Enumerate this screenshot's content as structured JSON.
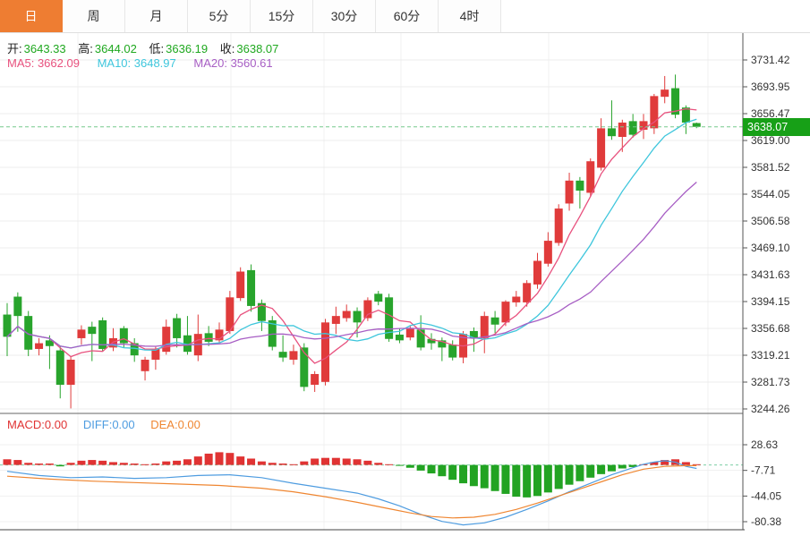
{
  "tabs": {
    "items": [
      {
        "label": "日",
        "active": true
      },
      {
        "label": "周",
        "active": false
      },
      {
        "label": "月",
        "active": false
      },
      {
        "label": "5分",
        "active": false
      },
      {
        "label": "15分",
        "active": false
      },
      {
        "label": "30分",
        "active": false
      },
      {
        "label": "60分",
        "active": false
      },
      {
        "label": "4时",
        "active": false
      }
    ]
  },
  "ohlc_legend": {
    "open_label": "开:",
    "open_value": "3643.33",
    "high_label": "高:",
    "high_value": "3644.02",
    "low_label": "低:",
    "low_value": "3636.19",
    "close_label": "收:",
    "close_value": "3638.07"
  },
  "ma_legend": {
    "ma5": "MA5: 3662.09",
    "ma10": "MA10: 3648.97",
    "ma20": "MA20: 3560.61"
  },
  "macd_legend": {
    "macd": "MACD:0.00",
    "diff": "DIFF:0.00",
    "dea": "DEA:0.00"
  },
  "price_tag": {
    "value": "3638.07"
  },
  "colors": {
    "accent_orange": "#ee7d32",
    "up_red": "#e03b3b",
    "down_green": "#28a42c",
    "tag_green": "#17a017",
    "ohlc_value_green": "#1fa81f",
    "ma5_pink": "#e8517e",
    "ma10_cyan": "#3ec6dc",
    "ma20_purple": "#a75ec4",
    "diff_blue": "#4e9ce0",
    "dea_orange": "#ef8631"
  },
  "chart_data": {
    "type": "candlestick+macd",
    "grid_x": [
      87,
      258,
      362,
      448,
      613,
      791
    ],
    "main": {
      "title": "",
      "ylabel": "price",
      "ylim": [
        3244.26,
        3731.42
      ],
      "y_ticks": [
        3731.42,
        3693.95,
        3656.47,
        3619.0,
        3581.52,
        3544.05,
        3506.58,
        3469.1,
        3431.63,
        3394.15,
        3356.68,
        3319.21,
        3281.73,
        3244.26
      ],
      "last_price": 3638.07,
      "up_color": "#e03b3b",
      "down_color": "#28a42c",
      "ma_periods": [
        5,
        10,
        20
      ],
      "ma_colors": [
        "#e8517e",
        "#3ec6dc",
        "#a75ec4"
      ],
      "ohlc": [
        [
          3376,
          3392,
          3318,
          3345
        ],
        [
          3401,
          3407,
          3352,
          3374
        ],
        [
          3374,
          3381,
          3318,
          3327
        ],
        [
          3328,
          3343,
          3319,
          3336
        ],
        [
          3340,
          3347,
          3300,
          3332
        ],
        [
          3326,
          3332,
          3259,
          3278
        ],
        [
          3278,
          3318,
          3245,
          3313
        ],
        [
          3343,
          3361,
          3334,
          3355
        ],
        [
          3359,
          3366,
          3311,
          3349
        ],
        [
          3368,
          3372,
          3325,
          3328
        ],
        [
          3330,
          3357,
          3325,
          3343
        ],
        [
          3357,
          3360,
          3330,
          3336
        ],
        [
          3336,
          3343,
          3310,
          3319
        ],
        [
          3297,
          3317,
          3284,
          3313
        ],
        [
          3313,
          3331,
          3299,
          3328
        ],
        [
          3324,
          3369,
          3320,
          3359
        ],
        [
          3371,
          3377,
          3330,
          3343
        ],
        [
          3347,
          3374,
          3320,
          3324
        ],
        [
          3319,
          3376,
          3311,
          3349
        ],
        [
          3350,
          3360,
          3332,
          3338
        ],
        [
          3340,
          3365,
          3336,
          3355
        ],
        [
          3353,
          3409,
          3349,
          3400
        ],
        [
          3399,
          3442,
          3395,
          3436
        ],
        [
          3438,
          3446,
          3380,
          3388
        ],
        [
          3392,
          3397,
          3353,
          3367
        ],
        [
          3368,
          3374,
          3326,
          3331
        ],
        [
          3324,
          3347,
          3310,
          3316
        ],
        [
          3313,
          3334,
          3306,
          3325
        ],
        [
          3330,
          3336,
          3269,
          3275
        ],
        [
          3278,
          3297,
          3268,
          3293
        ],
        [
          3282,
          3370,
          3277,
          3365
        ],
        [
          3363,
          3387,
          3349,
          3374
        ],
        [
          3371,
          3390,
          3366,
          3381
        ],
        [
          3381,
          3386,
          3344,
          3365
        ],
        [
          3371,
          3400,
          3367,
          3396
        ],
        [
          3405,
          3409,
          3389,
          3394
        ],
        [
          3400,
          3405,
          3338,
          3342
        ],
        [
          3348,
          3357,
          3336,
          3340
        ],
        [
          3344,
          3360,
          3340,
          3356
        ],
        [
          3355,
          3375,
          3326,
          3330
        ],
        [
          3342,
          3350,
          3327,
          3336
        ],
        [
          3340,
          3344,
          3311,
          3330
        ],
        [
          3334,
          3340,
          3312,
          3316
        ],
        [
          3316,
          3353,
          3308,
          3349
        ],
        [
          3353,
          3358,
          3324,
          3343
        ],
        [
          3343,
          3380,
          3322,
          3374
        ],
        [
          3372,
          3381,
          3350,
          3362
        ],
        [
          3365,
          3396,
          3360,
          3394
        ],
        [
          3393,
          3409,
          3387,
          3401
        ],
        [
          3393,
          3424,
          3387,
          3420
        ],
        [
          3418,
          3462,
          3412,
          3451
        ],
        [
          3447,
          3491,
          3443,
          3479
        ],
        [
          3476,
          3530,
          3472,
          3524
        ],
        [
          3531,
          3574,
          3521,
          3563
        ],
        [
          3563,
          3568,
          3524,
          3549
        ],
        [
          3546,
          3594,
          3541,
          3590
        ],
        [
          3581,
          3650,
          3577,
          3636
        ],
        [
          3636,
          3675,
          3620,
          3625
        ],
        [
          3624,
          3648,
          3603,
          3644
        ],
        [
          3646,
          3656,
          3623,
          3627
        ],
        [
          3634,
          3656,
          3621,
          3646
        ],
        [
          3636,
          3684,
          3628,
          3681
        ],
        [
          3680,
          3709,
          3671,
          3690
        ],
        [
          3692,
          3711,
          3650,
          3655
        ],
        [
          3665,
          3668,
          3628,
          3644
        ],
        [
          3643.33,
          3644.02,
          3636.19,
          3638.07
        ]
      ]
    },
    "macd": {
      "y_ticks": [
        28.63,
        -7.71,
        -44.05,
        -80.38
      ],
      "ylim": [
        -80.38,
        28.63
      ],
      "hist_up_color": "#e03333",
      "hist_down_color": "#22a322",
      "diff_color": "#4e9ce0",
      "dea_color": "#ef8631",
      "hist": [
        8,
        7,
        3,
        2,
        2,
        -2,
        3,
        6,
        7,
        6,
        4,
        3,
        2,
        1,
        2,
        5,
        6,
        8,
        12,
        16,
        18,
        17,
        12,
        9,
        5,
        3,
        2,
        1,
        5,
        9,
        10,
        10,
        9,
        8,
        6,
        3,
        1,
        -1,
        -4,
        -8,
        -12,
        -16,
        -21,
        -26,
        -30,
        -33,
        -37,
        -41,
        -45,
        -46,
        -44,
        -39,
        -34,
        -28,
        -23,
        -18,
        -13,
        -9,
        -5,
        -3,
        1,
        4,
        7,
        8,
        4,
        1
      ],
      "diff_points": [
        [
          0,
          -9
        ],
        [
          3,
          -15
        ],
        [
          6,
          -18
        ],
        [
          9,
          -17
        ],
        [
          12,
          -19
        ],
        [
          15,
          -18
        ],
        [
          18,
          -15
        ],
        [
          21,
          -14
        ],
        [
          24,
          -18
        ],
        [
          27,
          -26
        ],
        [
          30,
          -33
        ],
        [
          33,
          -40
        ],
        [
          35,
          -48
        ],
        [
          37,
          -58
        ],
        [
          39,
          -70
        ],
        [
          41,
          -80
        ],
        [
          43,
          -85
        ],
        [
          45,
          -82
        ],
        [
          47,
          -74
        ],
        [
          49,
          -63
        ],
        [
          51,
          -51
        ],
        [
          53,
          -38
        ],
        [
          55,
          -26
        ],
        [
          57,
          -14
        ],
        [
          59,
          -4
        ],
        [
          60,
          1
        ],
        [
          61,
          4
        ],
        [
          62,
          6
        ],
        [
          63,
          4
        ],
        [
          64,
          -2
        ],
        [
          65,
          -5
        ]
      ],
      "dea_points": [
        [
          0,
          -16
        ],
        [
          4,
          -20
        ],
        [
          8,
          -23
        ],
        [
          12,
          -25
        ],
        [
          16,
          -27
        ],
        [
          20,
          -29
        ],
        [
          24,
          -33
        ],
        [
          27,
          -38
        ],
        [
          30,
          -45
        ],
        [
          33,
          -53
        ],
        [
          36,
          -62
        ],
        [
          38,
          -68
        ],
        [
          40,
          -73
        ],
        [
          42,
          -75
        ],
        [
          44,
          -74
        ],
        [
          46,
          -70
        ],
        [
          48,
          -63
        ],
        [
          50,
          -54
        ],
        [
          52,
          -44
        ],
        [
          54,
          -34
        ],
        [
          56,
          -24
        ],
        [
          58,
          -14
        ],
        [
          60,
          -6
        ],
        [
          62,
          -2
        ],
        [
          64,
          -1
        ],
        [
          65,
          -1
        ]
      ]
    }
  }
}
